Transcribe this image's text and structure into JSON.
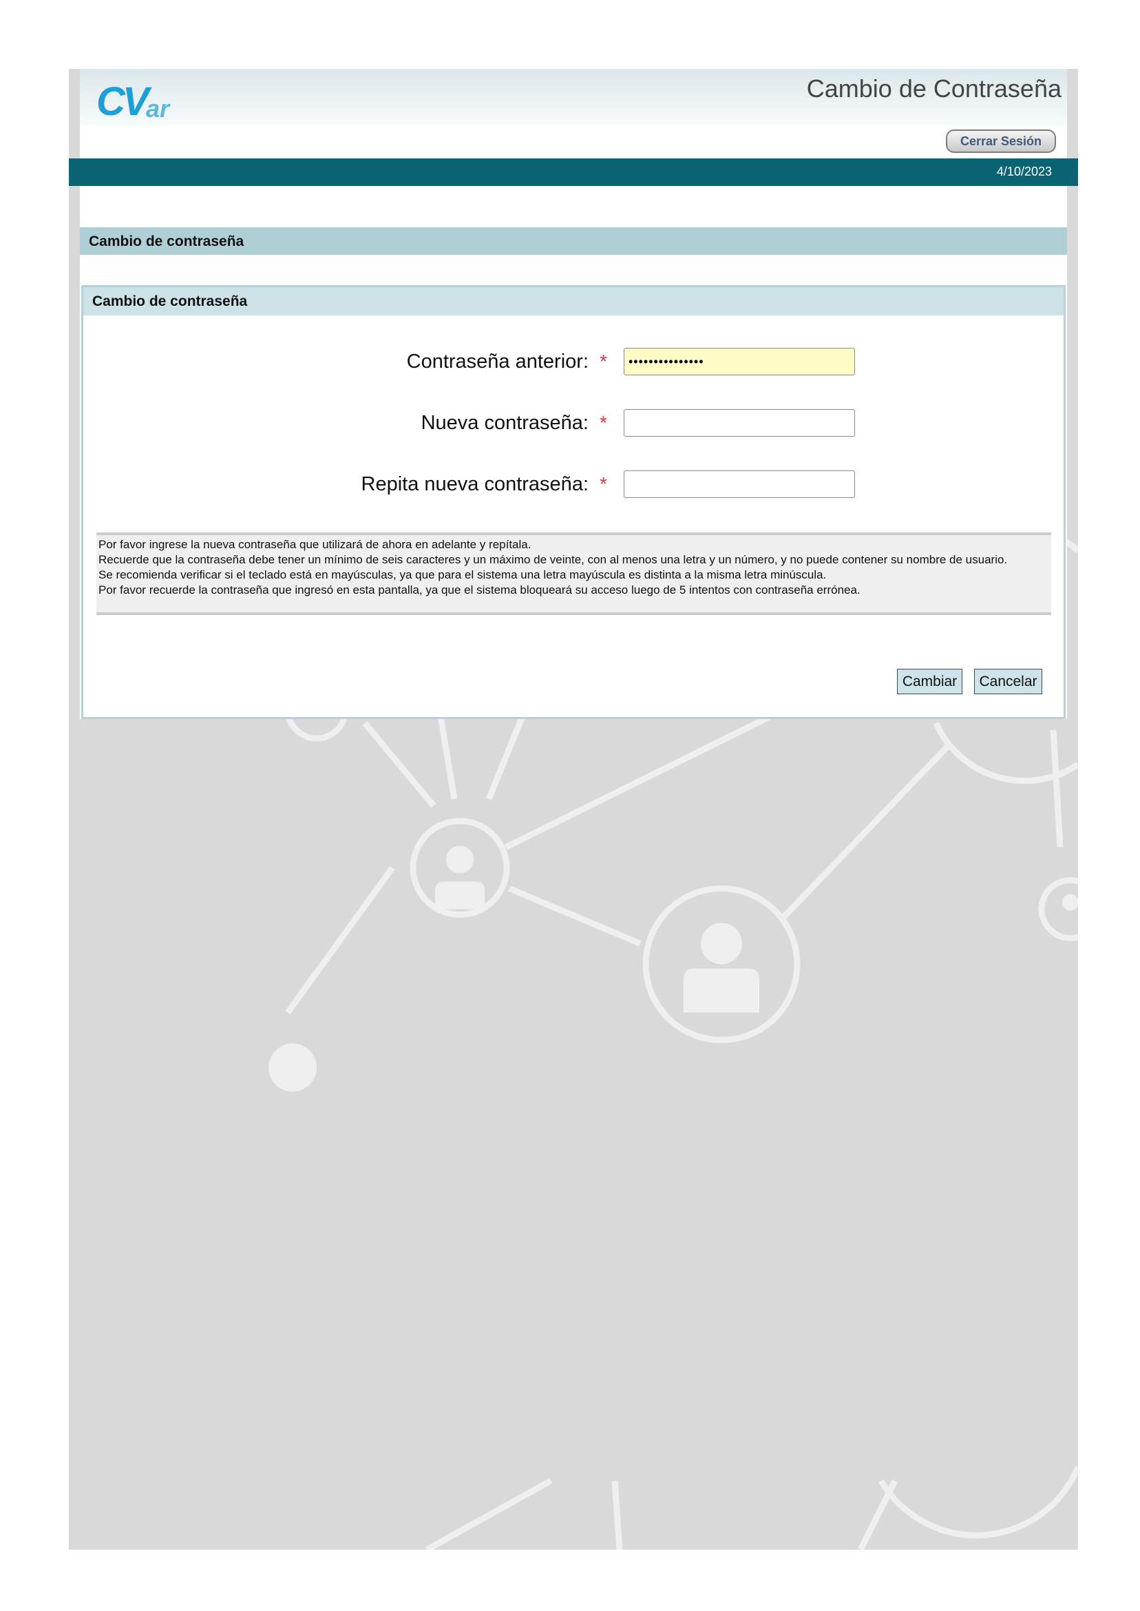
{
  "header": {
    "logo_text": "CVar",
    "title": "Cambio de Contraseña",
    "logout_label": "Cerrar Sesión"
  },
  "date": "4/10/2023",
  "section_title": "Cambio de contraseña",
  "panel": {
    "title": "Cambio de contraseña",
    "fields": {
      "old_password": {
        "label": "Contraseña anterior:",
        "required_mark": "*",
        "value": "•••••••••••••••"
      },
      "new_password": {
        "label": "Nueva contraseña:",
        "required_mark": "*",
        "value": ""
      },
      "repeat_password": {
        "label": "Repita nueva contraseña:",
        "required_mark": "*",
        "value": ""
      }
    },
    "info_lines": [
      "Por favor ingrese la nueva contraseña que utilizará de ahora en adelante y repítala.",
      "Recuerde que la contraseña debe tener un mínimo de seis caracteres y un máximo de veinte, con al menos una letra y un número, y no puede contener su nombre de usuario.",
      "Se recomienda verificar si el teclado está en mayúsculas, ya que para el sistema una letra mayúscula es distinta a la misma letra minúscula.",
      "Por favor recuerde la contraseña que ingresó en esta pantalla, ya que el sistema bloqueará su acceso luego de 5 intentos con contraseña errónea."
    ],
    "buttons": {
      "change": "Cambiar",
      "cancel": "Cancelar"
    }
  },
  "colors": {
    "date_bar": "#0a6474",
    "section_header": "#aecfd6",
    "panel_header": "#cde2e7",
    "input_filled": "#fffbc6",
    "required": "#e0393e",
    "logo": "#1e9fd8"
  },
  "icons": [
    "people-network-background"
  ]
}
